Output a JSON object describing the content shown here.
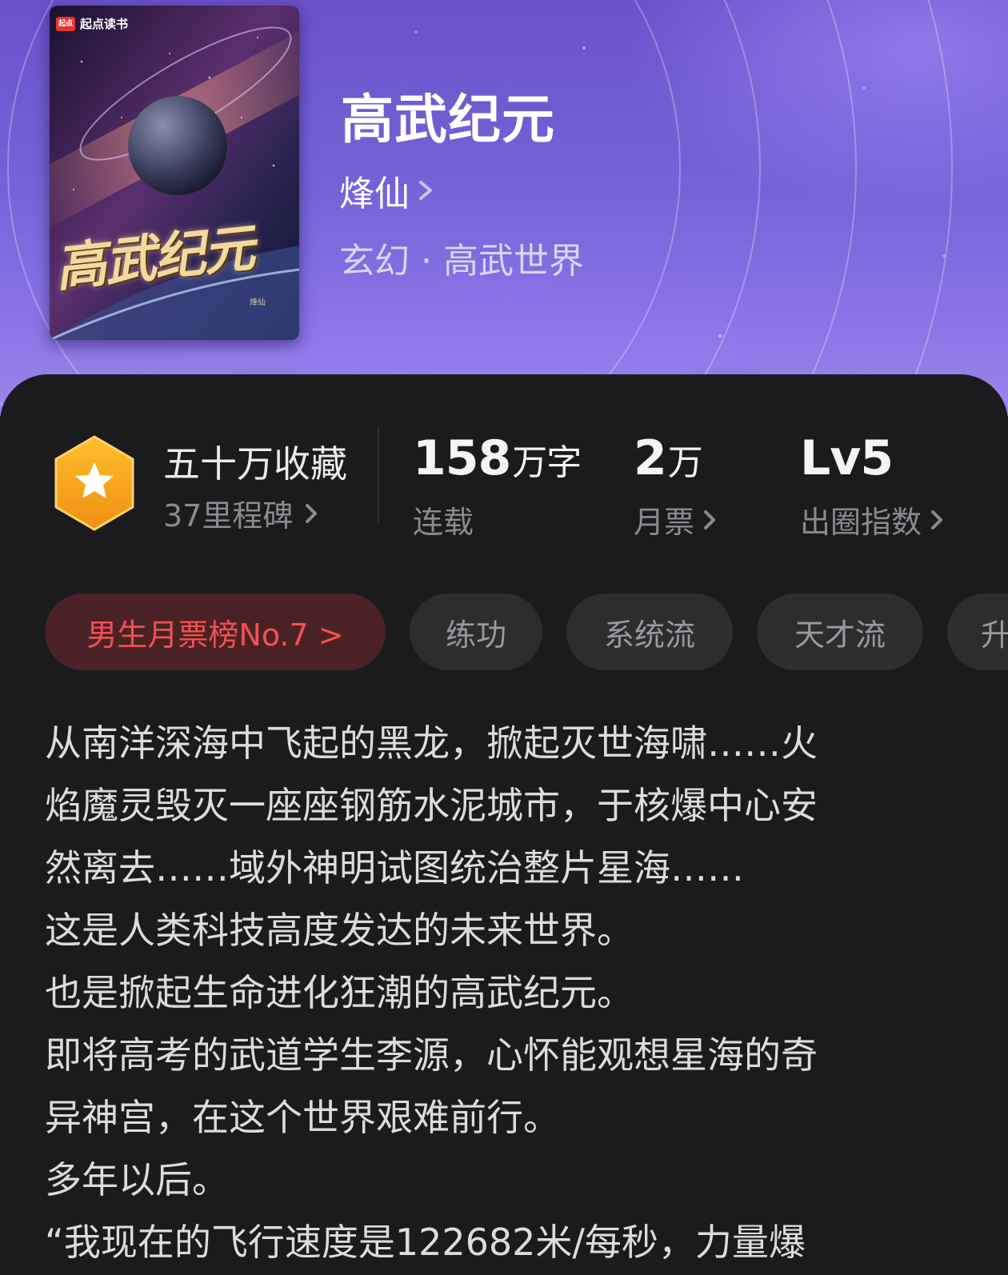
{
  "book": {
    "title": "高武纪元",
    "author": "烽仙",
    "genre": "玄幻 · 高武世界"
  },
  "cover": {
    "brand": "起点读书",
    "title_art": "高武纪元",
    "author": "烽仙"
  },
  "stats": {
    "collection": {
      "title": "五十万收藏",
      "subtitle": "37里程碑"
    },
    "words": {
      "value": "158",
      "unit": "万字",
      "label": "连载"
    },
    "monthly_ticket": {
      "value": "2",
      "unit": "万",
      "label": "月票"
    },
    "influence": {
      "value": "Lv5",
      "label": "出圈指数"
    }
  },
  "tags": [
    {
      "label": "男生月票榜No.7 >"
    },
    {
      "label": "练功"
    },
    {
      "label": "系统流"
    },
    {
      "label": "天才流"
    },
    {
      "label": "升"
    }
  ],
  "description_lines": [
    "从南洋深海中飞起的黑龙，掀起灭世海啸……火",
    "焰魔灵毁灭一座座钢筋水泥城市，于核爆中心安",
    "然离去……域外神明试图统治整片星海……",
    "这是人类科技高度发达的未来世界。",
    "也是掀起生命进化狂潮的高武纪元。",
    "即将高考的武道学生李源，心怀能观想星海的奇",
    "异神宫，在这个世界艰难前行。",
    "多年以后。",
    "“我现在的飞行速度是122682米/每秒，力量爆"
  ],
  "colors": {
    "header_purple": "#7662d8",
    "panel_bg": "#1b1b1d",
    "rank_tag_text": "#f35050",
    "badge_orange": "#f7a21b"
  }
}
